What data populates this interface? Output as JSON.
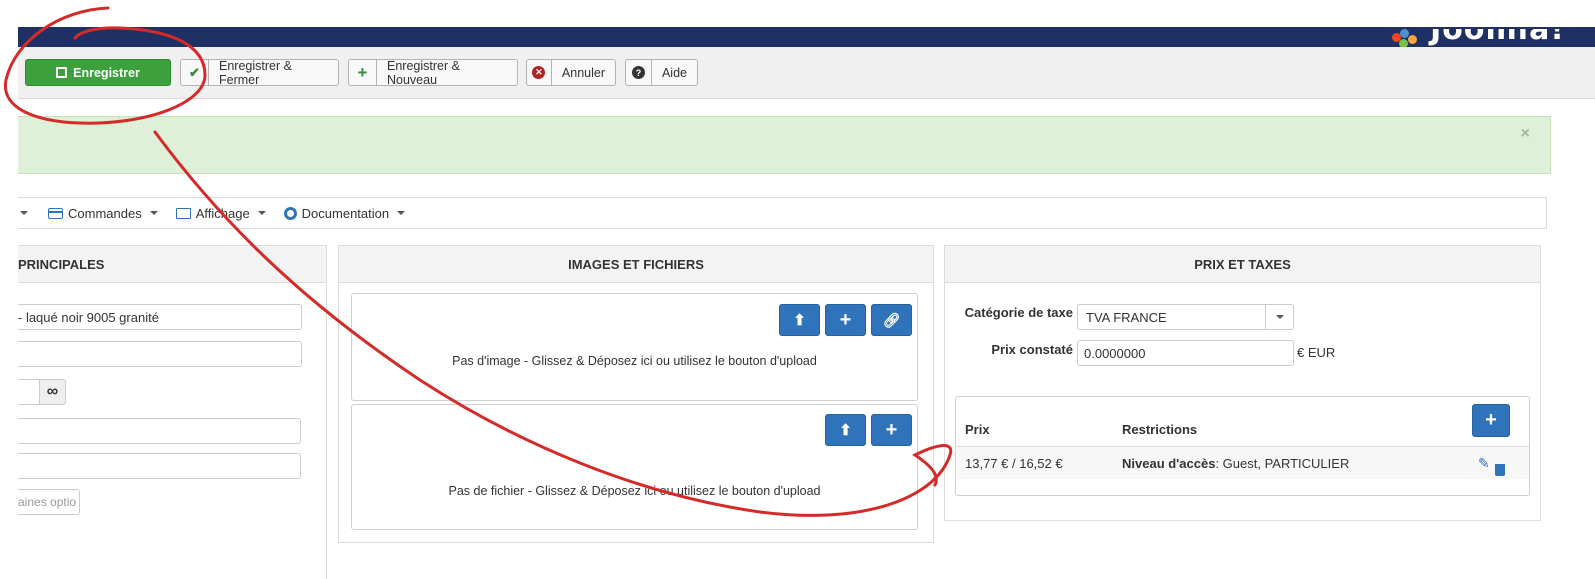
{
  "brand": {
    "name": "Joomla!"
  },
  "toolbar": {
    "save": "Enregistrer",
    "save_close": "Enregistrer & Fermer",
    "save_new": "Enregistrer & Nouveau",
    "cancel": "Annuler",
    "help": "Aide"
  },
  "alert": {
    "close": "×"
  },
  "menu": {
    "items": [
      "Commandes",
      "Affichage",
      "Documentation"
    ]
  },
  "panels": {
    "main": {
      "title": "PRINCIPALES",
      "name_value": "- laqué noir 9005 granité",
      "infinity_icon": "∞",
      "options_field": "aines optio"
    },
    "images": {
      "title": "IMAGES ET FICHIERS",
      "no_image": "Pas d'image - Glissez & Déposez ici ou utilisez le bouton d'upload",
      "no_file": "Pas de fichier - Glissez & Déposez ici ou utilisez le bouton d'upload"
    },
    "prices": {
      "title": "PRIX ET TAXES",
      "tax_label": "Catégorie de taxe",
      "tax_value": "TVA FRANCE",
      "price_label": "Prix constaté",
      "price_value": "0.0000000",
      "price_unit": "€ EUR",
      "col_price": "Prix",
      "col_restrictions": "Restrictions",
      "row_price": "13,77 € / 16,52 €",
      "row_access_label": "Niveau d'accès",
      "row_access_value": ": Guest, PARTICULIER"
    }
  },
  "colors": {
    "header": "#1f3164",
    "save_green": "#3ca03c",
    "primary_blue": "#2f73bb",
    "alert_green": "#dff0d8",
    "annotation_red": "#d42a2a"
  }
}
